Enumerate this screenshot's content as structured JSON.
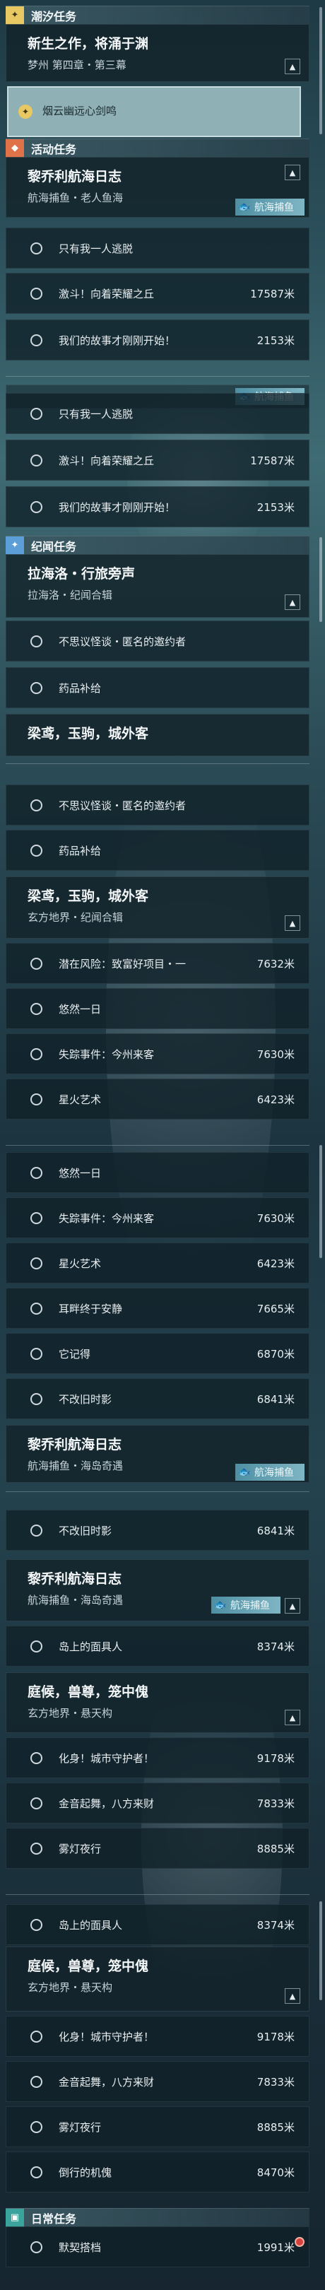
{
  "sections": {
    "main": "潮汐任务",
    "activity": "活动任务",
    "chronicle": "纪闻任务",
    "daily": "日常任务"
  },
  "main_card": {
    "title": "新生之作，将涌于渊",
    "sub": "梦州 第四章・第三幕"
  },
  "tracking": {
    "label": "烟云幽远心剑鸣"
  },
  "tag": "航海捕鱼",
  "unit": "米",
  "cards": {
    "lijiao_a": {
      "title": "黎乔利航海日志",
      "sub": "航海捕鱼・老人鱼海"
    },
    "lahailuo": {
      "title": "拉海洛・行旅旁声",
      "sub": "拉海洛・纪闻合辑"
    },
    "liangyuan": {
      "title": "梁鸢，玉驹，城外客",
      "sub": "玄方地界・纪闻合辑"
    },
    "lijiao_b": {
      "title": "黎乔利航海日志",
      "sub": "航海捕鱼・海岛奇遇"
    },
    "tinghou": {
      "title": "庭候，兽尊，笼中傀",
      "sub": "玄方地界・悬天构"
    }
  },
  "quests": {
    "alone": "只有我一人逃脱",
    "jidou": "激斗！向着荣耀之丘",
    "story": "我们的故事才刚刚开始！",
    "guaitan": "不思议怪谈・匿名的邀约者",
    "yaopin": "药品补给",
    "qianzai": "潜在风险：致富好项目・一",
    "youran": "悠然一日",
    "shizong": "失踪事件：今州来客",
    "xinghuo": "星火艺术",
    "erpang": "耳畔终于安静",
    "taji": "它记得",
    "buyi": "不改旧时影",
    "daoshang": "岛上的面具人",
    "huashen": "化身！城市守护者！",
    "jinxu": "金音起舞，八方来财",
    "wudeng": "雾灯夜行",
    "daolu": "倒行的机傀",
    "moyu": "默契搭档"
  },
  "dist": {
    "jidou": "17587",
    "story": "2153",
    "qianzai": "7632",
    "shizong": "7630",
    "xinghuo": "6423",
    "erpang": "7665",
    "taji": "6870",
    "buyi": "6841",
    "daoshang": "8374",
    "huashen": "9178",
    "jinxu": "7833",
    "wudeng": "8885",
    "daolu": "8470",
    "moyu": "1991"
  },
  "colors": {
    "main": "#e8c862",
    "activity": "#e0724a",
    "chronicle": "#5c9ed8",
    "daily": "#3aa39b",
    "tag": "#4e8fa3",
    "track": "#8fb0b4"
  }
}
